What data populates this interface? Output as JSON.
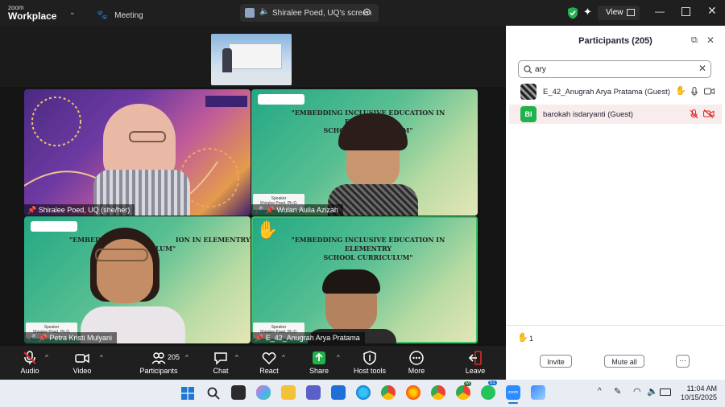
{
  "app": {
    "brand_line1": "zoom",
    "brand_line2": "Workplace",
    "meeting_label": "Meeting",
    "share_label": "Shiralee Poed, UQ's screen",
    "view_label": "View"
  },
  "tiles": [
    {
      "name": "Shiralee Poed, UQ (she/her)"
    },
    {
      "name": "Wulan Aulia Azizah"
    },
    {
      "name": "Petra Kristi Mulyani"
    },
    {
      "name": "E_42_Anugrah Arya Pratama"
    }
  ],
  "slide": {
    "title_line1": "\"EMBEDDING INCLUSIVE EDUCATION IN ELEMENTRY",
    "title_line2": "SCHOOL CURRICULUM\"",
    "speaker_label": "Speaker",
    "speaker_name": "Shiralee Poed, Ph.D.",
    "partial_title_line1": "\"EMBEDD",
    "partial_title_line1b": "ION IN ELEMENTRY",
    "partial_title_line2": "ULUM\""
  },
  "toolbar": {
    "audio": "Audio",
    "video": "Video",
    "participants": "Participants",
    "participants_count": "205",
    "chat": "Chat",
    "react": "React",
    "share": "Share",
    "host_tools": "Host tools",
    "more": "More",
    "leave": "Leave"
  },
  "panel": {
    "title": "Participants (205)",
    "search_value": "ary",
    "participants": [
      {
        "name": "E_42_Anugrah Arya Pratama (Guest)",
        "initials": ""
      },
      {
        "name": "barokah isdaryanti (Guest)",
        "initials": "BI"
      }
    ],
    "raised_count": "1",
    "invite_label": "Invite",
    "mute_all_label": "Mute all",
    "more_label": "···"
  },
  "taskbar": {
    "time": "11:04 AM",
    "date": "10/15/2025",
    "badge_m": "M",
    "badge_51": "51",
    "zoom_label": "zoom"
  },
  "colors": {
    "accent_green": "#21b24c",
    "hand_yellow": "#f5b400",
    "mute_red": "#e02828",
    "active_border": "#39c46a"
  }
}
